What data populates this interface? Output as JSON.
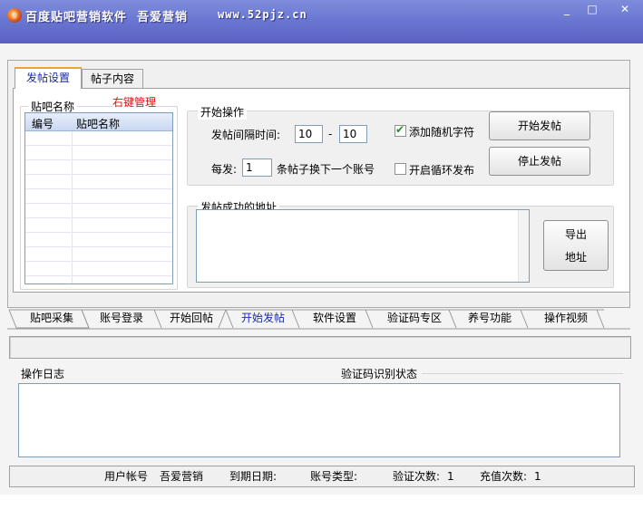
{
  "window": {
    "title": "百度贴吧营销软件  吾爱营销",
    "url": "www.52pjz.cn",
    "minimize": "_",
    "maximize": "□",
    "close": "✕"
  },
  "top_tabs": [
    {
      "label": "发帖设置",
      "active": true
    },
    {
      "label": "帖子内容",
      "active": false
    }
  ],
  "bar_list": {
    "group_label": "贴吧名称",
    "manage_hint": "右键管理",
    "columns": [
      "编号",
      "贴吧名称"
    ]
  },
  "start_ops": {
    "group_label": "开始操作",
    "interval_label": "发帖间隔时间:",
    "interval_from": "10",
    "interval_dash": "-",
    "interval_to": "10",
    "per_label": "每发:",
    "per_value": "1",
    "per_suffix": "条帖子换下一个账号",
    "random_char_label": "添加随机字符",
    "random_char_checked": true,
    "loop_label": "开启循环发布",
    "loop_checked": false,
    "start_button": "开始发帖",
    "stop_button": "停止发帖"
  },
  "success_urls": {
    "group_label": "发帖成功的地址",
    "export_button_line1": "导出",
    "export_button_line2": "地址"
  },
  "bottom_tabs": [
    {
      "label": "贴吧采集",
      "active": false
    },
    {
      "label": "账号登录",
      "active": false
    },
    {
      "label": "开始回帖",
      "active": false
    },
    {
      "label": "开始发帖",
      "active": true
    },
    {
      "label": "软件设置",
      "active": false
    },
    {
      "label": "验证码专区",
      "active": false
    },
    {
      "label": "养号功能",
      "active": false
    },
    {
      "label": "操作视频",
      "active": false
    }
  ],
  "log": {
    "label": "操作日志",
    "captcha_status_label": "验证码识别状态"
  },
  "footer": {
    "user_label": "用户帐号",
    "user_value": "吾爱营销",
    "expiry_label": "到期日期:",
    "type_label": "账号类型:",
    "verify_label": "验证次数:",
    "verify_value": "1",
    "recharge_label": "充值次数:",
    "recharge_value": "1"
  },
  "colors": {
    "title_bar": "#6a78d2",
    "active_tab_text": "#1a2da8",
    "manage_hint": "#e01010"
  }
}
